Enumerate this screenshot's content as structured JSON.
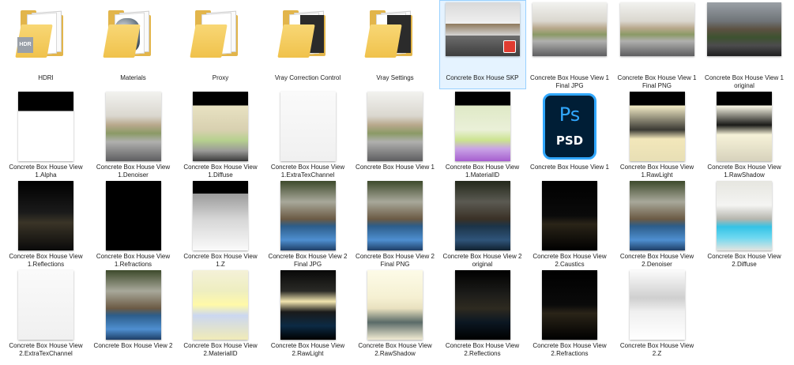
{
  "items": [
    {
      "label": "HDRI",
      "kind": "folder",
      "icon": "hdri-folder-icon",
      "badge": "HDR"
    },
    {
      "label": "Materials",
      "kind": "folder",
      "icon": "materials-folder-icon"
    },
    {
      "label": "Proxy",
      "kind": "folder",
      "icon": "proxy-folder-icon"
    },
    {
      "label": "Vray Correction Control",
      "kind": "folder",
      "icon": "vray-correction-folder-icon"
    },
    {
      "label": "Vray Settings",
      "kind": "folder",
      "icon": "vray-settings-folder-icon"
    },
    {
      "label": "Concrete Box House SKP",
      "kind": "image",
      "style": "skp",
      "selected": true
    },
    {
      "label": "Concrete Box House View 1 Final JPG",
      "kind": "image",
      "style": "day"
    },
    {
      "label": "Concrete Box House View 1 Final PNG",
      "kind": "image",
      "style": "day"
    },
    {
      "label": "Concrete Box House View 1 original",
      "kind": "image",
      "style": "dayDark"
    },
    {
      "label": "Concrete Box House View 1.Alpha",
      "kind": "image",
      "style": "alpha"
    },
    {
      "label": "Concrete Box House View 1.Denoiser",
      "kind": "image",
      "style": "day"
    },
    {
      "label": "Concrete Box House View 1.Diffuse",
      "kind": "image",
      "style": "diffuse"
    },
    {
      "label": "Concrete Box House View 1.ExtraTexChannel",
      "kind": "image",
      "style": "white"
    },
    {
      "label": "Concrete Box House View 1",
      "kind": "image",
      "style": "day"
    },
    {
      "label": "Concrete Box House View 1.MaterialID",
      "kind": "image",
      "style": "matid"
    },
    {
      "label": "Concrete Box House View 1",
      "kind": "psd",
      "logo": "Ps",
      "ext": "PSD"
    },
    {
      "label": "Concrete Box House View 1.RawLight",
      "kind": "image",
      "style": "rawlight"
    },
    {
      "label": "Concrete Box House View 1.RawShadow",
      "kind": "image",
      "style": "rawshadow"
    },
    {
      "label": "Concrete Box House View 1.Reflections",
      "kind": "image",
      "style": "darkRefl"
    },
    {
      "label": "Concrete Box House View 1.Refractions",
      "kind": "image",
      "style": "black"
    },
    {
      "label": "Concrete Box House View 1.Z",
      "kind": "image",
      "style": "zdepth"
    },
    {
      "label": "Concrete Box House View 2 Final JPG",
      "kind": "image",
      "style": "pool"
    },
    {
      "label": "Concrete Box House View 2 Final PNG",
      "kind": "image",
      "style": "pool"
    },
    {
      "label": "Concrete Box House View 2 original",
      "kind": "image",
      "style": "poolDark"
    },
    {
      "label": "Concrete Box House View 2.Caustics",
      "kind": "image",
      "style": "caustics"
    },
    {
      "label": "Concrete Box House View 2.Denoiser",
      "kind": "image",
      "style": "pool"
    },
    {
      "label": "Concrete Box House View 2.Diffuse",
      "kind": "image",
      "style": "poolDiffuse"
    },
    {
      "label": "Concrete Box House View 2.ExtraTexChannel",
      "kind": "image",
      "style": "white"
    },
    {
      "label": "Concrete Box House View 2",
      "kind": "image",
      "style": "pool"
    },
    {
      "label": "Concrete Box House View 2.MaterialID",
      "kind": "image",
      "style": "matid2"
    },
    {
      "label": "Concrete Box House View 2.RawLight",
      "kind": "image",
      "style": "poolRaw"
    },
    {
      "label": "Concrete Box House View 2.RawShadow",
      "kind": "image",
      "style": "poolShadow"
    },
    {
      "label": "Concrete Box House View 2.Reflections",
      "kind": "image",
      "style": "poolRefl"
    },
    {
      "label": "Concrete Box House View 2.Refractions",
      "kind": "image",
      "style": "caustics"
    },
    {
      "label": "Concrete Box House View 2.Z",
      "kind": "image",
      "style": "zdepth2"
    }
  ],
  "colors": {
    "selection_bg": "#e5f3ff",
    "selection_border": "#99d1ff",
    "folder": "#f0c24c",
    "ps_blue": "#31a8ff",
    "ps_bg": "#001e36"
  }
}
